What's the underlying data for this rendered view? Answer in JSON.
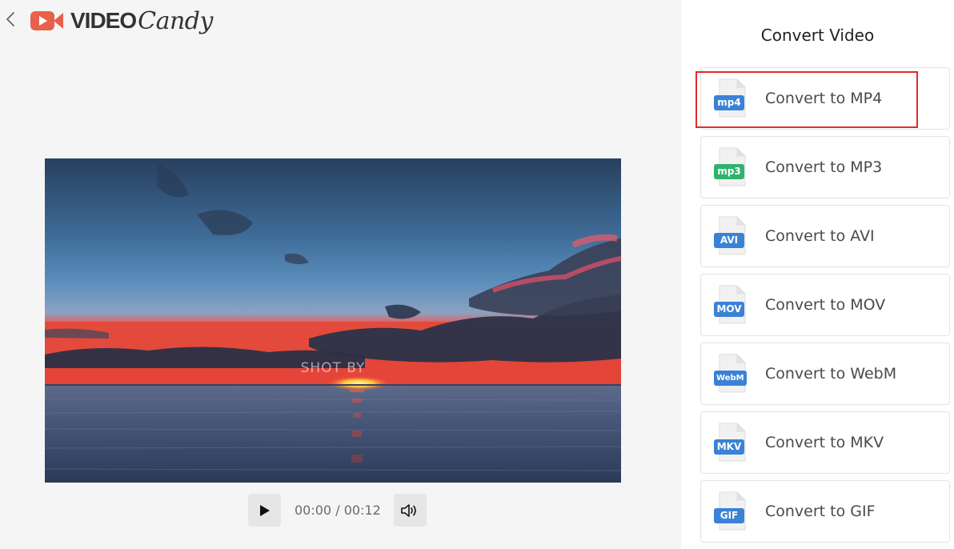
{
  "header": {
    "logo_video": "VIDEO",
    "logo_candy": "Candy",
    "back_icon": "chevron-left-icon"
  },
  "player": {
    "overlay_text": "SHOT BY",
    "time_current": "00:00",
    "time_separator": "/",
    "time_total": "00:12",
    "play_icon": "play-icon",
    "volume_icon": "volume-icon"
  },
  "panel": {
    "title": "Convert Video",
    "options": [
      {
        "badge": "mp4",
        "label": "Convert to MP4",
        "color": "#3b82d6"
      },
      {
        "badge": "mp3",
        "label": "Convert to MP3",
        "color": "#2fb36c"
      },
      {
        "badge": "AVI",
        "label": "Convert to AVI",
        "color": "#3b82d6"
      },
      {
        "badge": "MOV",
        "label": "Convert to MOV",
        "color": "#3b82d6"
      },
      {
        "badge": "WebM",
        "label": "Convert to WebM",
        "color": "#3b82d6"
      },
      {
        "badge": "MKV",
        "label": "Convert to MKV",
        "color": "#3b82d6"
      },
      {
        "badge": "GIF",
        "label": "Convert to GIF",
        "color": "#3b82d6"
      }
    ]
  },
  "colors": {
    "brand": "#e8604c",
    "highlight": "#e02b2b",
    "blue_badge": "#3b82d6",
    "green_badge": "#2fb36c"
  }
}
